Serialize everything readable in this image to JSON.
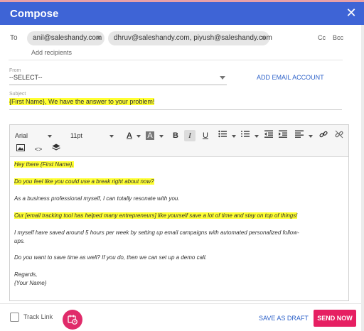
{
  "header": {
    "title": "Compose",
    "close_glyph": "✕"
  },
  "to": {
    "label": "To",
    "recipients": [
      {
        "text": "anil@saleshandy.com",
        "remove": "×"
      },
      {
        "text": "dhruv@saleshandy.com, piyush@saleshandy.com",
        "remove": "×"
      }
    ],
    "cc": "Cc",
    "bcc": "Bcc",
    "add_recipients": "Add recipients"
  },
  "from": {
    "label": "From",
    "value": "--SELECT--",
    "add_account": "ADD EMAIL ACCOUNT"
  },
  "subject": {
    "label": "Subject",
    "value": "{First Name}, We have the answer to your problem!"
  },
  "toolbar": {
    "font_family": "Arial",
    "font_size": "11pt",
    "icons": [
      "text-color-icon",
      "highlight-color-icon",
      "bold-icon",
      "italic-icon",
      "underline-icon",
      "bullet-list-icon",
      "numbered-list-icon",
      "outdent-icon",
      "indent-icon",
      "align-icon",
      "link-icon",
      "unlink-icon",
      "image-icon",
      "code-icon",
      "layers-icon"
    ],
    "glyphs": {
      "text_color": "A",
      "highlight": "A",
      "bold": "B",
      "italic": "I",
      "underline": "U",
      "code": "<>"
    }
  },
  "body": {
    "greeting": "Hey there {First Name},",
    "p1": "Do you feel like you could use a break right about now?",
    "p2": "As a business professional myself, I can totally resonate with you.",
    "p3": "Our [email tracking tool has helped many entrepreneurs] like yourself save a lot of time and stay on top of things!",
    "p4a": "I myself have saved around 5 hours per week by setting up email campaigns with automated personalized follow-",
    "p4b": "ups.",
    "p5": "Do you want to save time as well? If you do, then we can set up a demo call.",
    "signoff": "Regards,",
    "signature": "{Your Name}"
  },
  "footer": {
    "track_link": "Track Link",
    "save_draft": "SAVE AS DRAFT",
    "send_now": "SEND NOW"
  },
  "colors": {
    "header": "#3e64d6",
    "highlight": "#ffff33",
    "accent": "#e61f62",
    "link": "#2e62c9"
  }
}
